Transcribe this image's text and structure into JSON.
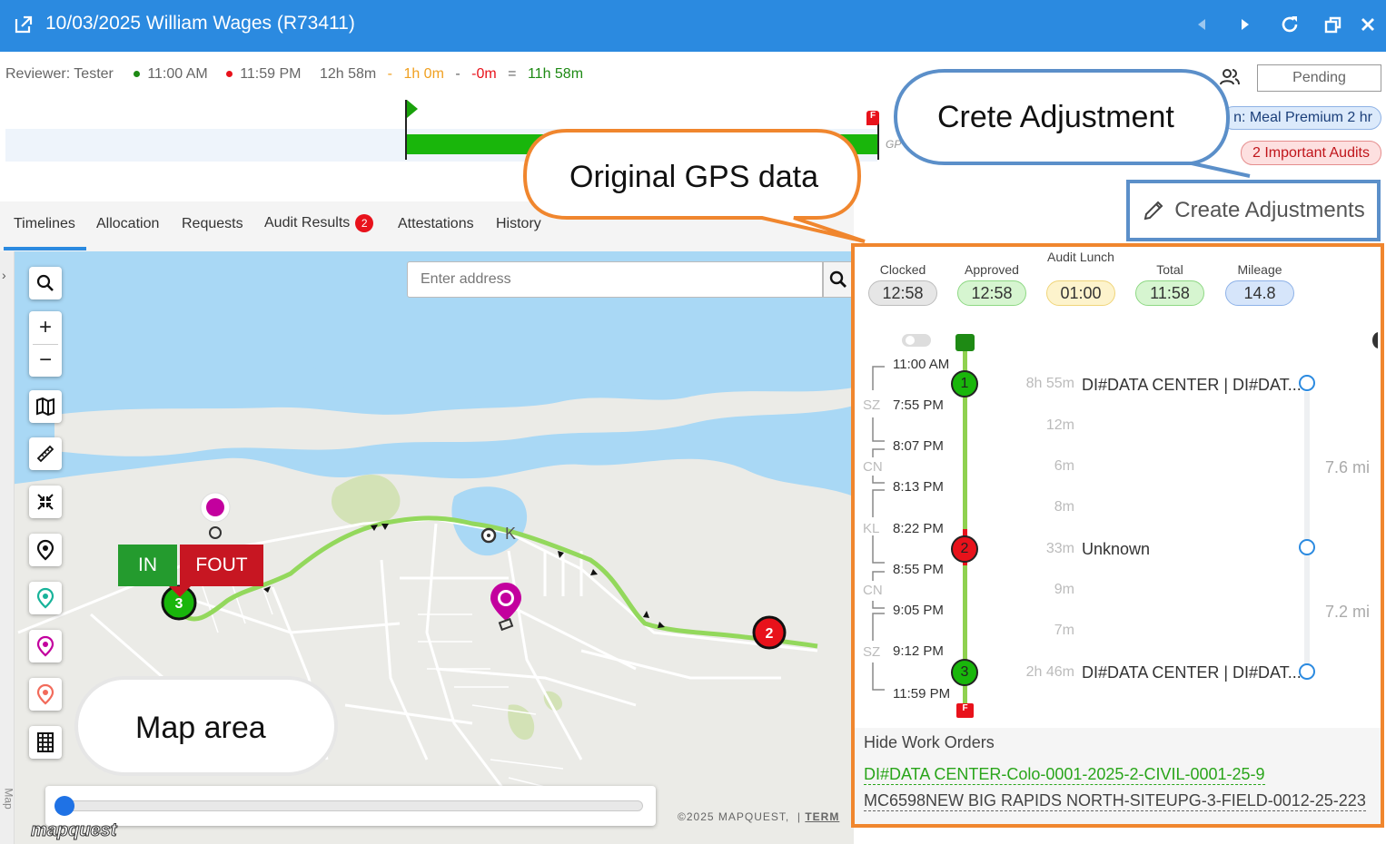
{
  "window": {
    "title": "10/03/2025 William Wages (R73411)",
    "icons": [
      "external-link-icon",
      "prev-icon",
      "next-icon",
      "refresh-icon",
      "restore-icon",
      "close-icon"
    ]
  },
  "summary": {
    "reviewer": "Reviewer: Tester",
    "start_time": "11:00 AM",
    "end_time": "11:59 PM",
    "span": "12h 58m",
    "sep1": "-",
    "lunch": "1h 0m",
    "sep2": "-",
    "minus": "-0m",
    "eq": "=",
    "net": "11h 58m",
    "colors": {
      "start": "#1e8a14",
      "end": "#e8121b",
      "lunch": "#f0a020",
      "minus": "#e8121b",
      "net": "#1e8a14"
    }
  },
  "timeline": {
    "gps_label": "GP",
    "end_flag": "F"
  },
  "header_right": {
    "pending": "Pending",
    "meal_badge": "n: Meal Premium 2 hr",
    "audit_badge": "2 Important Audits",
    "create_adjustments": "Create Adjustments"
  },
  "tabs": [
    {
      "label": "Timelines",
      "active": true
    },
    {
      "label": "Allocation"
    },
    {
      "label": "Requests"
    },
    {
      "label": "Audit Results",
      "badge": "2"
    },
    {
      "label": "Attestations"
    },
    {
      "label": "History"
    }
  ],
  "map": {
    "side_label": "Map",
    "search_placeholder": "Enter address",
    "copyright": "©2025 MAPQUEST,",
    "terms": "TERM",
    "logo": "mapquest",
    "flag_in": "IN",
    "flag_fout": "FOUT",
    "marker_1": "3",
    "marker_2": "2",
    "stop_label": "K",
    "slider_position": 0,
    "tools": [
      "search-icon",
      "zoom-in-icon",
      "zoom-out-icon",
      "map-icon",
      "ruler-icon",
      "collapse-icon",
      "location-pin-icon",
      "teal-pin-icon",
      "magenta-pin-icon",
      "orange-pin-icon",
      "grid-icon"
    ]
  },
  "callouts": {
    "gps": "Original GPS data",
    "adjustment": "Crete Adjustment",
    "map_area": "Map area"
  },
  "stats": [
    {
      "label": "Clocked",
      "value": "12:58",
      "bg": "#e6e6e6",
      "border": "#bdbdbd"
    },
    {
      "label": "Approved",
      "value": "12:58",
      "bg": "#d6f5d0",
      "border": "#8ed884"
    },
    {
      "label": "Audit Lunch",
      "value": "01:00",
      "bg": "#fdf3cc",
      "border": "#f0d57a"
    },
    {
      "label": "Total",
      "value": "11:58",
      "bg": "#d6f5d0",
      "border": "#8ed884"
    },
    {
      "label": "Mileage",
      "value": "14.8",
      "bg": "#d6e5fa",
      "border": "#8eb2e8"
    }
  ],
  "timeline_panel": {
    "times": [
      "11:00 AM",
      "7:55 PM",
      "8:07 PM",
      "8:13 PM",
      "8:22 PM",
      "8:55 PM",
      "9:05 PM",
      "9:12 PM",
      "11:59 PM"
    ],
    "codes": [
      "SZ",
      "CN",
      "KL",
      "CN",
      "SZ"
    ],
    "nodes": [
      {
        "num": "1",
        "duration": "8h 55m",
        "place": "DI#DATA CENTER | DI#DAT..."
      },
      {
        "num": "2",
        "duration": "33m",
        "place": "Unknown"
      },
      {
        "num": "3",
        "duration": "2h 46m",
        "place": "DI#DATA CENTER | DI#DAT..."
      }
    ],
    "travel": [
      "12m",
      "6m",
      "8m",
      "9m",
      "7m"
    ],
    "miles": [
      "7.6 mi",
      "7.2 mi"
    ],
    "end_flag": "F"
  },
  "work_orders": {
    "title": "Hide Work Orders",
    "items": [
      "DI#DATA CENTER-Colo-0001-2025-2-CIVIL-0001-25-9",
      "MC6598NEW BIG RAPIDS NORTH-SITEUPG-3-FIELD-0012-25-223"
    ]
  }
}
